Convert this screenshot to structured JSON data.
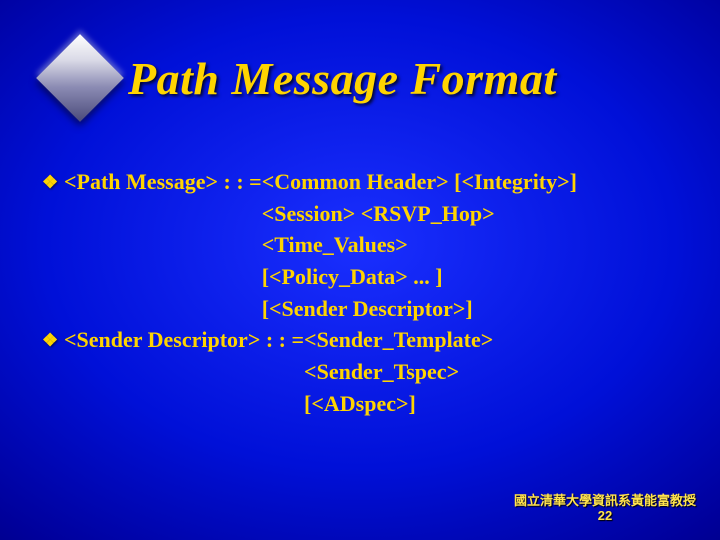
{
  "slide": {
    "title": "Path Message Format",
    "bullets": [
      {
        "lhs": "<Path Message> : : = ",
        "rhs": [
          "<Common Header> [<Integrity>]",
          "<Session> <RSVP_Hop>",
          "<Time_Values>",
          "[<Policy_Data> ... ]",
          "[<Sender Descriptor>]"
        ]
      },
      {
        "lhs": "<Sender Descriptor> : : = ",
        "rhs": [
          "<Sender_Template>",
          "<Sender_Tspec>",
          "[<ADspec>]"
        ]
      }
    ],
    "footer_line1": "國立清華大學資訊系黃能富教授",
    "footer_line2": "22",
    "bullet_glyph": "❖"
  }
}
